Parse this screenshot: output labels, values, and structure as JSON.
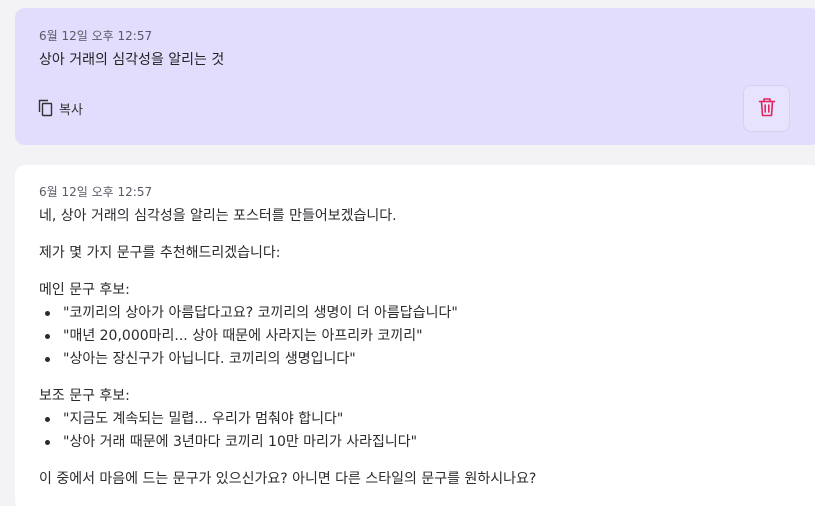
{
  "user_message": {
    "timestamp": "6월 12일 오후 12:57",
    "text": "상아 거래의 심각성을 알리는 것",
    "copy_label": "복사",
    "copy_icon": "copy-icon",
    "delete_icon": "trash-icon",
    "delete_icon_color": "#e0245e"
  },
  "assistant_message": {
    "timestamp": "6월 12일 오후 12:57",
    "intro": "네, 상아 거래의 심각성을 알리는 포스터를 만들어보겠습니다.",
    "lead": "제가 몇 가지 문구를 추천해드리겠습니다:",
    "main_heading": "메인 문구 후보:",
    "main_items": [
      "\"코끼리의 상아가 아름답다고요? 코끼리의 생명이 더 아름답습니다\"",
      "\"매년 20,000마리... 상아 때문에 사라지는 아프리카 코끼리\"",
      "\"상아는 장신구가 아닙니다. 코끼리의 생명입니다\""
    ],
    "sub_heading": "보조 문구 후보:",
    "sub_items": [
      "\"지금도 계속되는 밀렵... 우리가 멈춰야 합니다\"",
      "\"상아 거래 때문에 3년마다 코끼리 10만 마리가 사라집니다\""
    ],
    "closing": "이 중에서 마음에 드는 문구가 있으신가요? 아니면 다른 스타일의 문구를 원하시나요?"
  }
}
